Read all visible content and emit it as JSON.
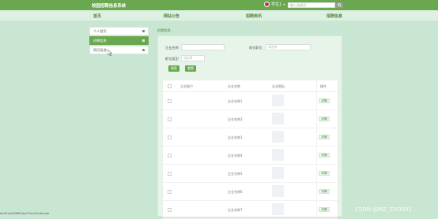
{
  "topbar": {
    "brand": "校园招聘信息系统",
    "user_name": "学生1",
    "search_placeholder": "输入关键词",
    "avatar_icon": "avatar-icon",
    "search_icon": "search-icon"
  },
  "nav": {
    "items": [
      "首页",
      "网站公告",
      "招聘资讯",
      "招聘信息"
    ]
  },
  "sidebar": {
    "items": [
      {
        "label": "个人首页",
        "active": false
      },
      {
        "label": "招聘信息",
        "active": true
      },
      {
        "label": "简历投递",
        "active": false
      }
    ]
  },
  "breadcrumb": "招聘信息",
  "form": {
    "company_name_label": "企业名称",
    "job_title_label": "岗位职位",
    "job_title_placeholder": "请选择",
    "job_type_label": "职位类型",
    "job_type_placeholder": "请选择",
    "search_button": "搜索",
    "reset_button": "重置"
  },
  "table": {
    "headers": [
      "企业账户",
      "企业名称",
      "企业图标",
      "操作"
    ],
    "rows": [
      {
        "name": "企业名称1",
        "action": "详情"
      },
      {
        "name": "企业名称2",
        "action": "详情"
      },
      {
        "name": "企业名称3",
        "action": "详情"
      },
      {
        "name": "企业名称4",
        "action": "详情"
      },
      {
        "name": "企业名称5",
        "action": "详情"
      },
      {
        "name": "企业名称6",
        "action": "详情"
      },
      {
        "name": "企业名称7",
        "action": "详情"
      }
    ]
  },
  "statusbar": "localhost:8080/jsp7/front/index.jsp",
  "watermark": "CSDN @MZ_ZXD001",
  "colors": {
    "accent": "#6aa84f",
    "background": "#c9e6d2"
  }
}
